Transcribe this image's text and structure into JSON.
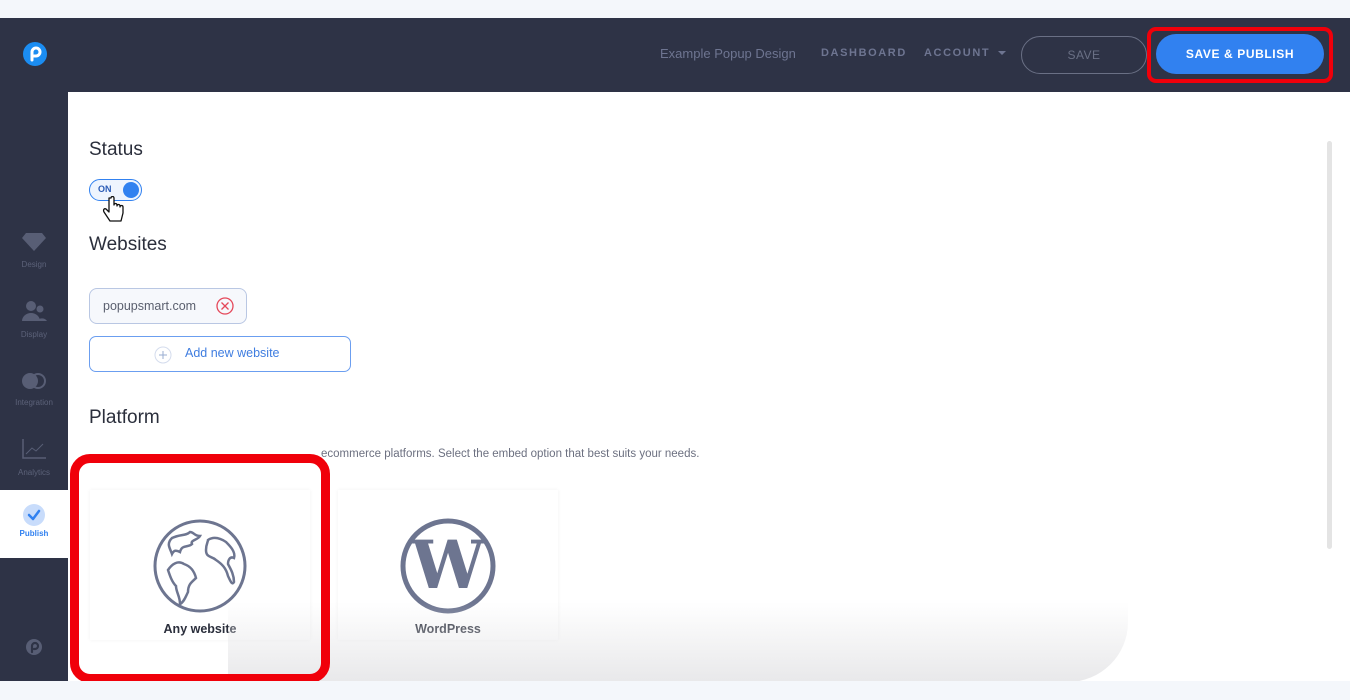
{
  "header": {
    "design_name": "Example Popup Design",
    "dashboard_label": "DASHBOARD",
    "account_label": "ACCOUNT",
    "save_label": "SAVE",
    "save_publish_label": "SAVE & PUBLISH",
    "logo_icon": "popupsmart-logo-icon"
  },
  "sidebar": {
    "items": [
      {
        "label": "Design",
        "icon": "diamond-icon"
      },
      {
        "label": "Display",
        "icon": "users-icon"
      },
      {
        "label": "Integration",
        "icon": "toggle-icon"
      },
      {
        "label": "Analytics",
        "icon": "chart-icon"
      },
      {
        "label": "Publish",
        "icon": "check-icon",
        "active": true
      }
    ],
    "footer_icon": "popupsmart-logo-icon"
  },
  "status": {
    "heading": "Status",
    "toggle_label": "ON",
    "toggle_state": true
  },
  "websites": {
    "heading": "Websites",
    "items": [
      "popupsmart.com"
    ],
    "add_label": "Add new website"
  },
  "platform": {
    "heading": "Platform",
    "description": "ecommerce platforms. Select the embed option that best suits your needs.",
    "options": [
      {
        "label": "Any website",
        "icon": "globe-icon"
      },
      {
        "label": "WordPress",
        "icon": "wordpress-icon"
      }
    ]
  },
  "colors": {
    "topbar_bg": "#2e3346",
    "accent": "#3181f0",
    "highlight": "#f0000a",
    "remove_icon": "#e5485a"
  }
}
